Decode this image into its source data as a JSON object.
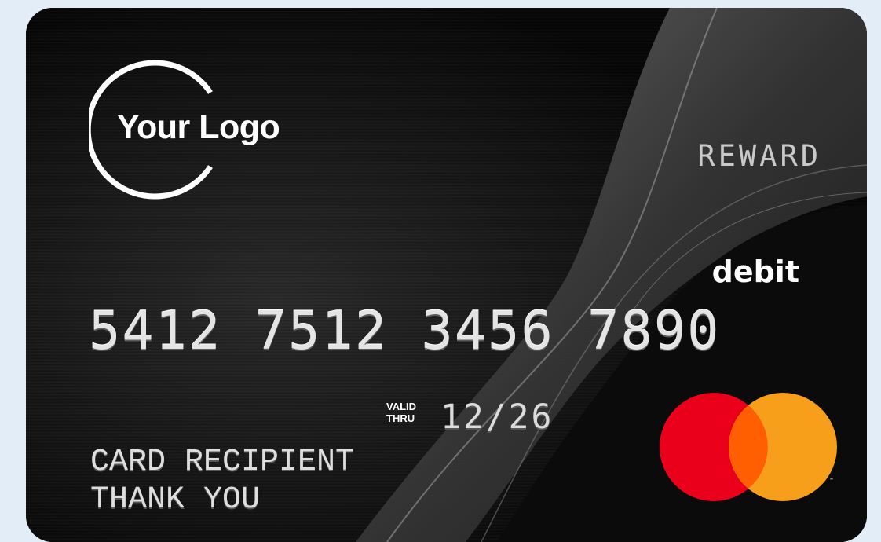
{
  "card": {
    "logo_text": "Your Logo",
    "program_label": "REWARD",
    "card_type": "debit",
    "card_number": "5412 7512 3456 7890",
    "valid_thru_line1": "VALID",
    "valid_thru_line2": "THRU",
    "expiry": "12/26",
    "holder_line1": "CARD RECIPIENT",
    "holder_line2": "THANK YOU",
    "trademark": "™"
  },
  "colors": {
    "page_background": "#e3edf8",
    "card_base": "#0c0c0c",
    "mastercard_red": "#eb001b",
    "mastercard_orange": "#f79e1b",
    "mastercard_overlap": "#ff5f00"
  },
  "icons": {
    "brand_logo": "mastercard-logo",
    "logo_ring": "circle-ring-logo"
  }
}
